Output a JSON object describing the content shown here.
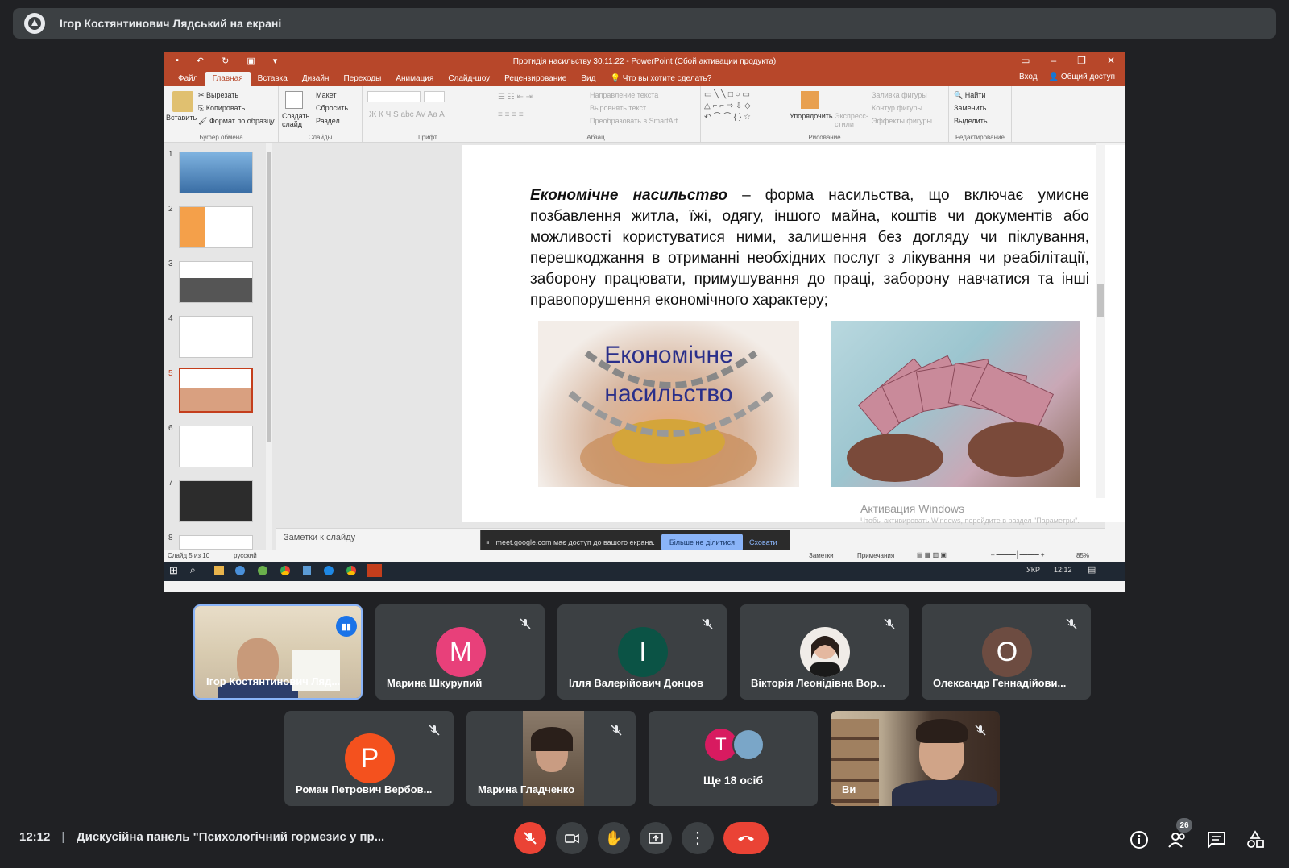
{
  "banner": {
    "title": "Ігор Костянтинович Лядський на екрані"
  },
  "powerpoint": {
    "title_bar": "Протидія насильству 30.11.22 - PowerPoint (Сбой активации продукта)",
    "tabs": [
      "Файл",
      "Главная",
      "Вставка",
      "Дизайн",
      "Переходы",
      "Анимация",
      "Слайд-шоу",
      "Рецензирование",
      "Вид"
    ],
    "search": "Что вы хотите сделать?",
    "sign_in": "Вход",
    "share": "Общий доступ",
    "ribbon": {
      "paste": "Вставить",
      "cut": "Вырезать",
      "copy": "Копировать",
      "format_painter": "Формат по образцу",
      "group_clipboard": "Буфер обмена",
      "new_slide": "Создать слайд",
      "layout": "Макет",
      "reset": "Сбросить",
      "section": "Раздел",
      "group_slides": "Слайды",
      "group_font": "Шрифт",
      "text_direction": "Направление текста",
      "align_text": "Выровнять текст",
      "convert_smartart": "Преобразовать в SmartArt",
      "group_paragraph": "Абзац",
      "arrange": "Упорядочить",
      "quick_styles": "Экспресс-стили",
      "shape_fill": "Заливка фигуры",
      "shape_outline": "Контур фигуры",
      "shape_effects": "Эффекты фигуры",
      "group_drawing": "Рисование",
      "find": "Найти",
      "replace": "Заменить",
      "select": "Выделить",
      "group_editing": "Редактирование"
    },
    "thumbs": [
      "1",
      "2",
      "3",
      "4",
      "5",
      "6",
      "7",
      "8"
    ],
    "slide": {
      "lead": "Економічне насильство",
      "body": " – форма насильства, що включає умисне позбавлення житла, їжі, одягу, іншого майна, коштів чи документів або можливості користуватися ними, залишення без догляду чи піклування, перешкоджання в отриманні необхідних послуг з лікування чи реабілітації, заборону працювати, примушування до праці, заборону навчатися та інші правопорушення економічного характеру;",
      "image_text_1": "Економічне",
      "image_text_2": "насильство"
    },
    "notes_label": "Заметки к слайду",
    "status_slide": "Слайд 5 из 10",
    "status_lang": "русский",
    "status_notes": "Заметки",
    "status_comments": "Примечания",
    "zoom": "85%",
    "watermark_title": "Активация Windows",
    "watermark_sub": "Чтобы активировать Windows, перейдите в раздел \"Параметры\".",
    "share_bar": {
      "text": "meet.google.com має доступ до вашого екрана.",
      "stop": "Більше не ділитися",
      "hide": "Сховати"
    },
    "taskbar": {
      "lang": "УКР",
      "time": "12:12"
    }
  },
  "participants": [
    {
      "name": "Ігор Костянтинович Ляд...",
      "initial": "",
      "color": ""
    },
    {
      "name": "Марина Шкурупий",
      "initial": "M",
      "color": "#e8407a"
    },
    {
      "name": "Ілля Валерійович Донцов",
      "initial": "I",
      "color": "#0b5345"
    },
    {
      "name": "Вікторія Леонідівна Вор...",
      "initial": "",
      "color": ""
    },
    {
      "name": "Олександр Геннадійови...",
      "initial": "O",
      "color": "#6d4c41"
    },
    {
      "name": "Роман Петрович Вербов...",
      "initial": "P",
      "color": "#f4511e"
    },
    {
      "name": "Марина Гладченко",
      "initial": "",
      "color": ""
    },
    {
      "name": "Ще 18 осіб",
      "initial": "T",
      "color": "#d81b60"
    },
    {
      "name": "Ви",
      "initial": "",
      "color": ""
    }
  ],
  "meeting": {
    "time": "12:12",
    "title": "Дискусійна панель \"Психологічний гормезис у пр...",
    "people_count": "26"
  }
}
